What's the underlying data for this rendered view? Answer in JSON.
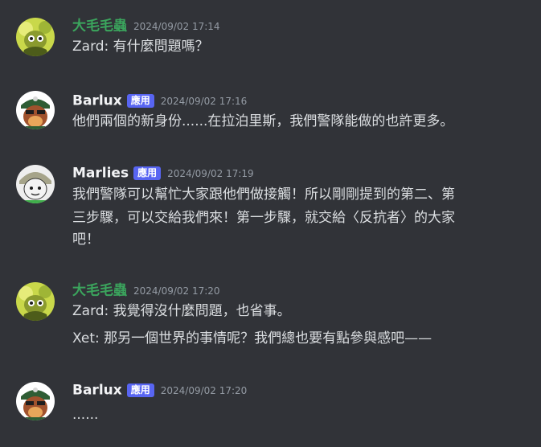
{
  "colors": {
    "background": "#313338",
    "green_username": "#3ba55d",
    "white_username": "#f2f3f5",
    "tag_bg": "#5865f2",
    "timestamp": "#949ba4",
    "text": "#dbdee1"
  },
  "messages": [
    {
      "username": "大毛毛蟲",
      "timestamp": "2024/09/02 17:14",
      "lines": [
        "Zard: 有什麼問題嗎？"
      ],
      "avatar_icon": "yellow-cartoon-avatar-icon"
    },
    {
      "username": "Barlux",
      "tag": "應用",
      "timestamp": "2024/09/02 17:16",
      "lines": [
        "他們兩個的新身份......在拉泊里斯，我們警隊能做的也許更多。"
      ],
      "avatar_icon": "green-hat-bear-avatar-icon"
    },
    {
      "username": "Marlies",
      "tag": "應用",
      "timestamp": "2024/09/02 17:19",
      "lines": [
        "我們警隊可以幫忙大家跟他們做接觸！所以剛剛提到的第二、第",
        "三步驟，可以交給我們來！第一步驟，就交給〈反抗者〉的大家",
        "吧！"
      ],
      "avatar_icon": "white-hair-character-avatar-icon"
    },
    {
      "username": "大毛毛蟲",
      "timestamp": "2024/09/02 17:20",
      "lines": [
        "Zard: 我覺得沒什麼問題，也省事。",
        "Xet: 那另一個世界的事情呢？我們總也要有點參與感吧——"
      ],
      "avatar_icon": "yellow-cartoon-avatar-icon"
    },
    {
      "username": "Barlux",
      "tag": "應用",
      "timestamp": "2024/09/02 17:20",
      "lines": [
        "......"
      ],
      "avatar_icon": "green-hat-bear-avatar-icon"
    }
  ]
}
